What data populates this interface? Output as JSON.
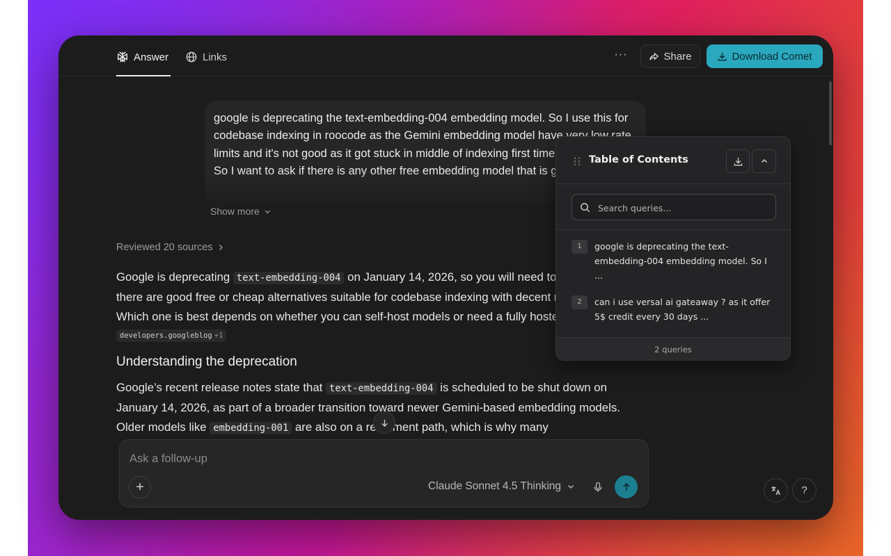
{
  "header": {
    "tabs": [
      {
        "label": "Answer",
        "icon": "perplexity-icon",
        "active": true
      },
      {
        "label": "Links",
        "icon": "globe-icon",
        "active": false
      }
    ],
    "more_label": "···",
    "share_label": "Share",
    "download_label": "Download Comet",
    "accent_color": "#2aa8be"
  },
  "query": {
    "lines": [
      "google is deprecating the text-embedding-004 embedding model. So I use this for codebase indexing in roocode as the Gemini embedding model have very low rate limits and it's not good as it got stuck in middle of indexing first time.",
      "So I want to ask if there is any other free embedding model that is good"
    ],
    "show_more": "Show more"
  },
  "sources": {
    "label": "Reviewed 20 sources"
  },
  "answer": {
    "p1": {
      "before": "Google is deprecating ",
      "code": "text-embedding-004",
      "after": " on January 14, 2026, so you will need to migrate, but there are good free or cheap alternatives suitable for codebase indexing with decent rate limits. Which one is best depends on whether you can self-host models or need a fully hosted API. ",
      "citation": "developers.googleblog",
      "citation_more": "+1"
    },
    "heading": "Understanding the deprecation",
    "p2": {
      "t1": "Google’s recent release notes state that ",
      "code1": "text-embedding-004",
      "t2": " is scheduled to be shut down on January 14, 2026, as part of a broader transition toward newer Gemini-based embedding models. Older models like ",
      "code2": "embedding-001",
      "t3": " are also on a retirement path, which is why many"
    }
  },
  "followup": {
    "placeholder": "Ask a follow-up",
    "model": "Claude Sonnet 4.5 Thinking",
    "plus": "+"
  },
  "help_label": "?",
  "toc": {
    "title": "Table of Contents",
    "search_placeholder": "Search queries...",
    "items": [
      {
        "num": "1",
        "text": "google is deprecating the text-embedding-004 embedding model. So I ..."
      },
      {
        "num": "2",
        "text": "can i use versal ai gateaway ? as it offer 5$ credit every 30 days ..."
      }
    ],
    "footer": "2 queries"
  }
}
